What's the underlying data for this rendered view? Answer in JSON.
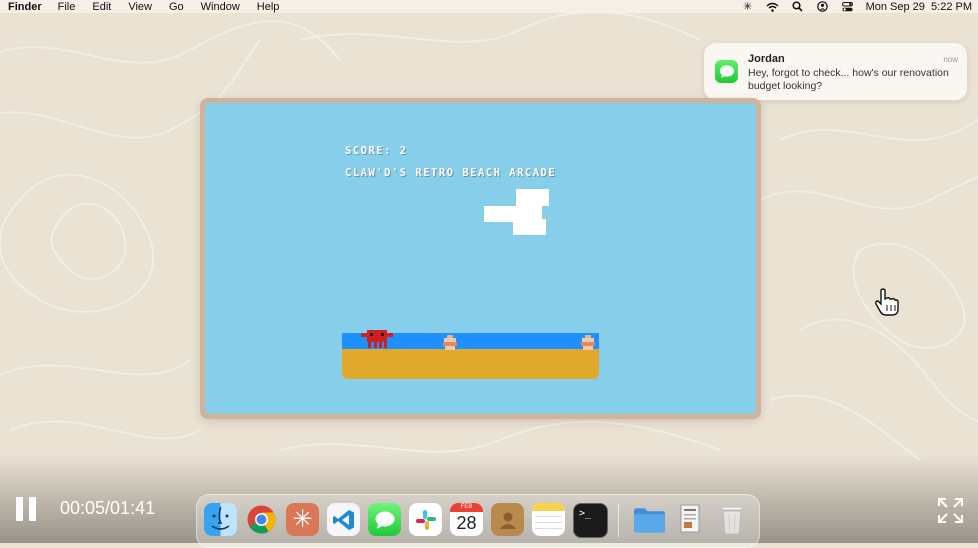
{
  "menubar": {
    "app": "Finder",
    "items": [
      "File",
      "Edit",
      "View",
      "Go",
      "Window",
      "Help"
    ],
    "datetime": "Mon Sep 29  5:22 PM"
  },
  "notification": {
    "sender": "Jordan",
    "time": "now",
    "message": "Hey, forgot to check... how's our renovation budget looking?"
  },
  "game": {
    "score_text": "SCORE: 2",
    "title_text": "CLAW'D'S RETRO BEACH ARCADE"
  },
  "player": {
    "timecode": "00:05/01:41"
  },
  "dock": {
    "calendar_month": "FEB",
    "calendar_day": "28",
    "apps": [
      "finder-icon",
      "chrome-icon",
      "claude-icon",
      "vscode-icon",
      "messages-icon",
      "slack-icon",
      "calendar-icon",
      "contacts-icon",
      "notes-icon",
      "terminal-icon",
      "folder-icon",
      "document-icon",
      "trash-icon"
    ]
  },
  "colors": {
    "sky": "#87ceeb",
    "water": "#1e90ff",
    "sand": "#e0a92b",
    "crab": "#d11f1f",
    "frame": "#d3b29a"
  }
}
